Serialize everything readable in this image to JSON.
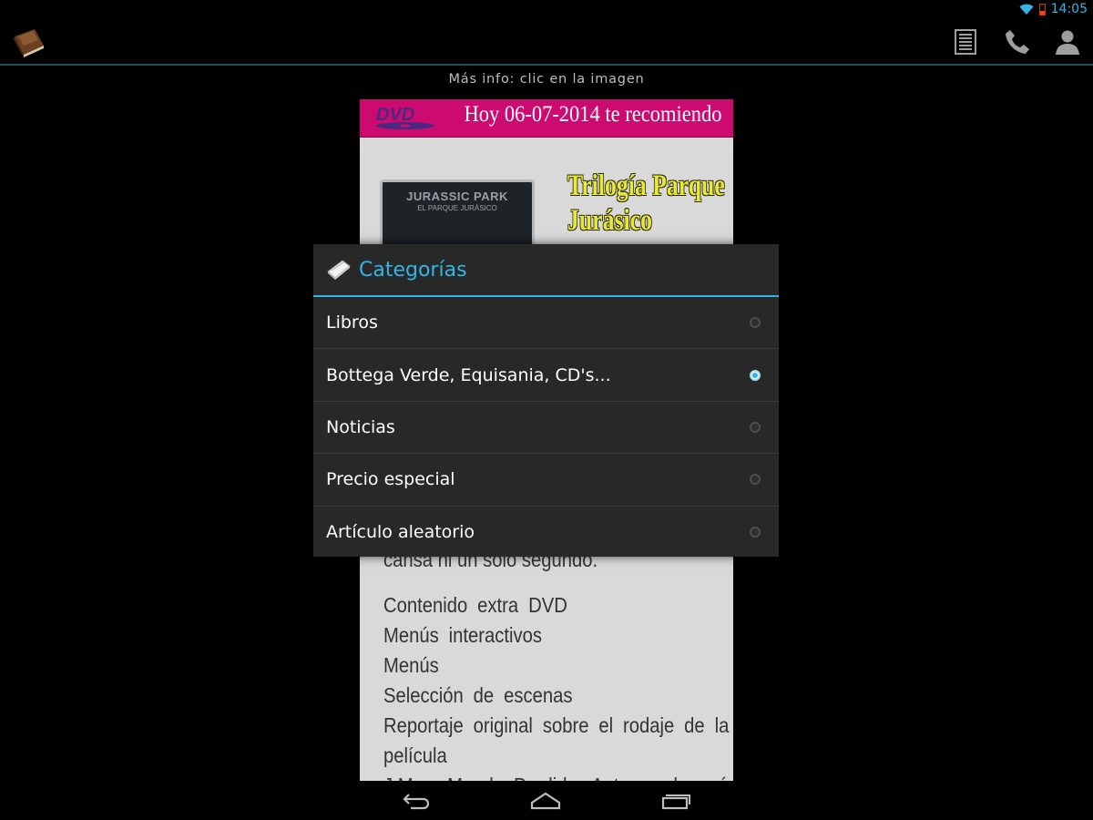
{
  "status_bar": {
    "time": "14:05"
  },
  "action_bar": {
    "app_icon": "book-icon",
    "actions": [
      "list-icon",
      "phone-icon",
      "contact-icon"
    ]
  },
  "content": {
    "info_text": "Más info: clic en la imagen",
    "card": {
      "header_logo": "DVD",
      "header_title": "Hoy 06-07-2014 te recomiendo",
      "cover_title": "JURASSIC PARK",
      "cover_subtitle": "EL PARQUE JURÁSICO",
      "movie_title_line1": "Trilogía Parque",
      "movie_title_line2": "Jurásico",
      "partial_text": "cansa ni un solo segundo.",
      "features": [
        "Contenido extra DVD",
        "Menús interactivos",
        "Menús",
        "Selección de escenas",
        "Reportaje original sobre el rodaje de la",
        "película",
        "J.M. y Mundo Perdido: Antes y después de"
      ]
    }
  },
  "dialog": {
    "title": "Categorías",
    "icon": "book-icon",
    "options": [
      {
        "label": "Libros",
        "selected": false
      },
      {
        "label": "Bottega Verde, Equisania, CD's...",
        "selected": true
      },
      {
        "label": "Noticias",
        "selected": false
      },
      {
        "label": "Precio especial",
        "selected": false
      },
      {
        "label": "Artículo aleatorio",
        "selected": false
      }
    ]
  },
  "nav_bar": {
    "buttons": [
      "back-icon",
      "home-icon",
      "recents-icon"
    ]
  },
  "colors": {
    "accent": "#33b5e5",
    "header_pink": "#cc0a70",
    "dialog_bg": "#282828"
  }
}
